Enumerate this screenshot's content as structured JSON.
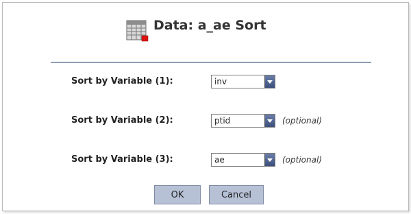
{
  "dialog": {
    "title": "Data: a_ae Sort",
    "icon": "table-icon"
  },
  "sort_rows": [
    {
      "label": "Sort by Variable (1):",
      "selected": "inv",
      "optional": ""
    },
    {
      "label": "Sort by Variable (2):",
      "selected": "ptid",
      "optional": "(optional)"
    },
    {
      "label": "Sort by Variable (3):",
      "selected": "ae",
      "optional": "(optional)"
    }
  ],
  "buttons": {
    "ok": "OK",
    "cancel": "Cancel"
  }
}
